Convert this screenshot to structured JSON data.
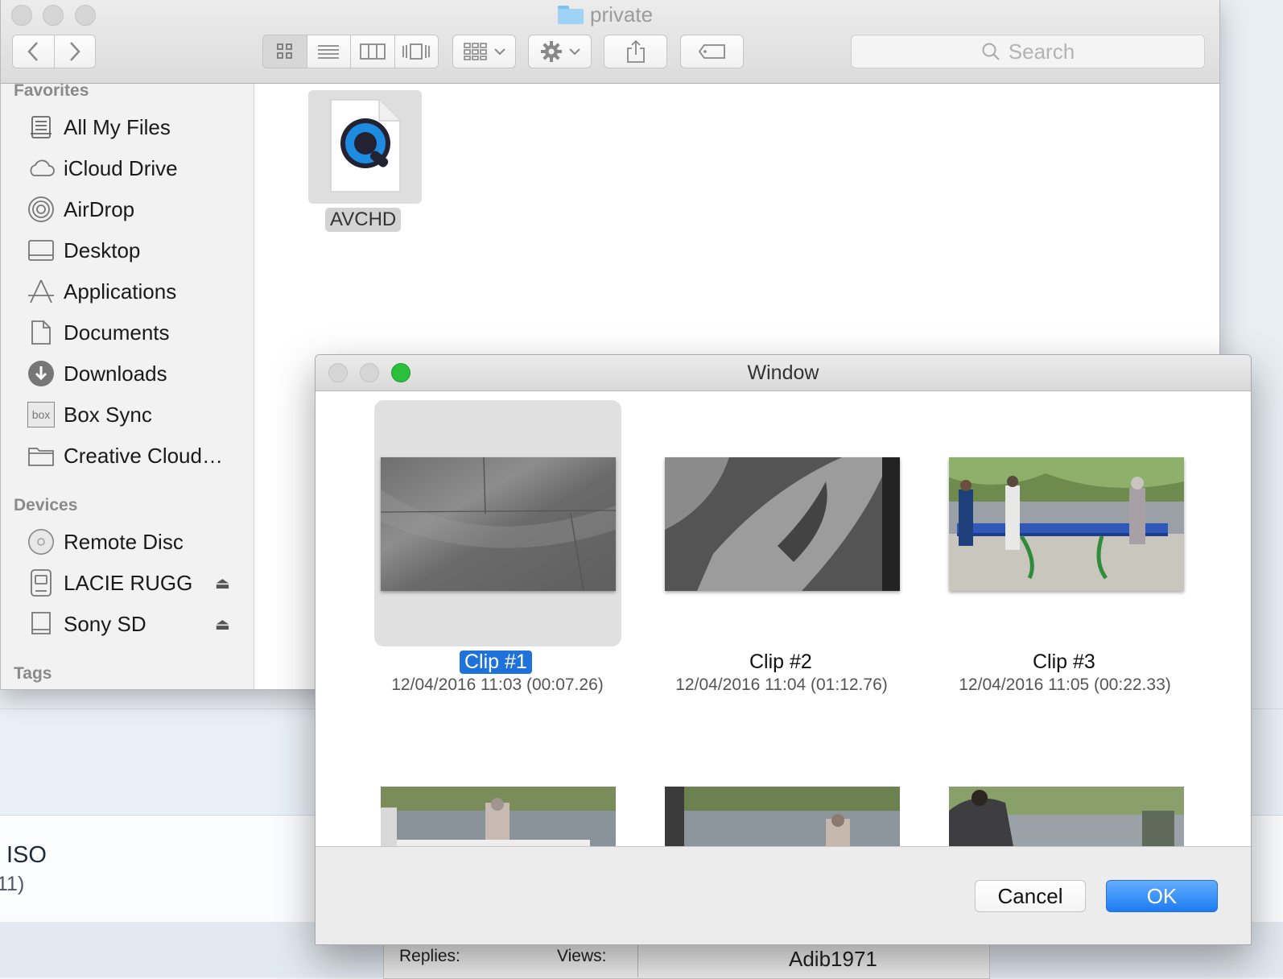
{
  "background_page": {
    "item_title": "ISO",
    "item_sub": "11)",
    "table": {
      "col1": "Replies:",
      "col2": "Views:",
      "col3": "Adib1971"
    }
  },
  "finder": {
    "title": "private",
    "search_placeholder": "Search",
    "sidebar": {
      "favorites_header": "Favorites",
      "favorites": [
        {
          "label": "All My Files",
          "icon": "all-my-files-icon"
        },
        {
          "label": "iCloud Drive",
          "icon": "cloud-icon"
        },
        {
          "label": "AirDrop",
          "icon": "airdrop-icon"
        },
        {
          "label": "Desktop",
          "icon": "desktop-icon"
        },
        {
          "label": "Applications",
          "icon": "applications-icon"
        },
        {
          "label": "Documents",
          "icon": "documents-icon"
        },
        {
          "label": "Downloads",
          "icon": "downloads-icon"
        },
        {
          "label": "Box Sync",
          "icon": "box-icon",
          "icon_text": "box"
        },
        {
          "label": "Creative Cloud…",
          "icon": "folder-icon"
        }
      ],
      "devices_header": "Devices",
      "devices": [
        {
          "label": "Remote Disc",
          "icon": "disc-icon"
        },
        {
          "label": "LACIE RUGG",
          "icon": "drive-icon",
          "eject": "⏏"
        },
        {
          "label": "Sony SD",
          "icon": "sd-card-icon",
          "eject": "⏏"
        }
      ],
      "tags_header": "Tags"
    },
    "files": [
      {
        "name": "AVCHD",
        "icon": "quicktime-file-icon"
      }
    ]
  },
  "dialog": {
    "title": "Window",
    "clips": [
      {
        "name": "Clip #1",
        "meta": "12/04/2016 11:03 (00:07.26)",
        "selected": true
      },
      {
        "name": "Clip #2",
        "meta": "12/04/2016 11:04 (01:12.76)",
        "selected": false
      },
      {
        "name": "Clip #3",
        "meta": "12/04/2016 11:05 (00:22.33)",
        "selected": false
      }
    ],
    "cancel_label": "Cancel",
    "ok_label": "OK"
  },
  "colors": {
    "accent": "#1f72d9",
    "ok_button": "#1d7cf2",
    "zoom_button": "#2bbf3c"
  }
}
